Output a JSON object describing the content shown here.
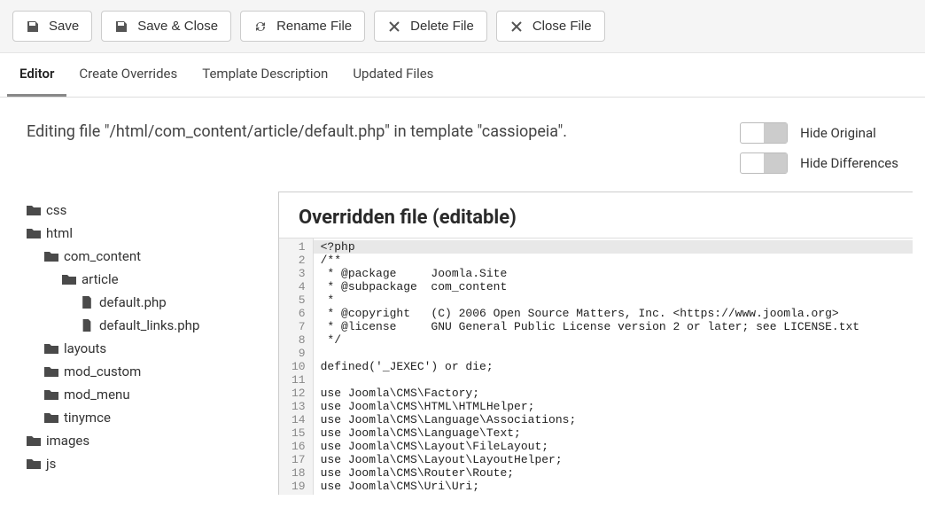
{
  "toolbar": {
    "save": "Save",
    "save_close": "Save & Close",
    "rename": "Rename File",
    "delete": "Delete File",
    "close": "Close File"
  },
  "tabs": {
    "editor": "Editor",
    "overrides": "Create Overrides",
    "description": "Template Description",
    "updated": "Updated Files"
  },
  "editing_text": "Editing file \"/html/com_content/article/default.php\" in template \"cassiopeia\".",
  "toggles": {
    "hide_original": "Hide Original",
    "hide_differences": "Hide Differences"
  },
  "tree": {
    "css": "css",
    "html": "html",
    "com_content": "com_content",
    "article": "article",
    "default_php": "default.php",
    "default_links_php": "default_links.php",
    "layouts": "layouts",
    "mod_custom": "mod_custom",
    "mod_menu": "mod_menu",
    "tinymce": "tinymce",
    "images": "images",
    "js": "js"
  },
  "editor": {
    "title": "Overridden file (editable)",
    "lines": [
      "<?php",
      "/**",
      " * @package     Joomla.Site",
      " * @subpackage  com_content",
      " *",
      " * @copyright   (C) 2006 Open Source Matters, Inc. <https://www.joomla.org>",
      " * @license     GNU General Public License version 2 or later; see LICENSE.txt",
      " */",
      "",
      "defined('_JEXEC') or die;",
      "",
      "use Joomla\\CMS\\Factory;",
      "use Joomla\\CMS\\HTML\\HTMLHelper;",
      "use Joomla\\CMS\\Language\\Associations;",
      "use Joomla\\CMS\\Language\\Text;",
      "use Joomla\\CMS\\Layout\\FileLayout;",
      "use Joomla\\CMS\\Layout\\LayoutHelper;",
      "use Joomla\\CMS\\Router\\Route;",
      "use Joomla\\CMS\\Uri\\Uri;"
    ]
  }
}
